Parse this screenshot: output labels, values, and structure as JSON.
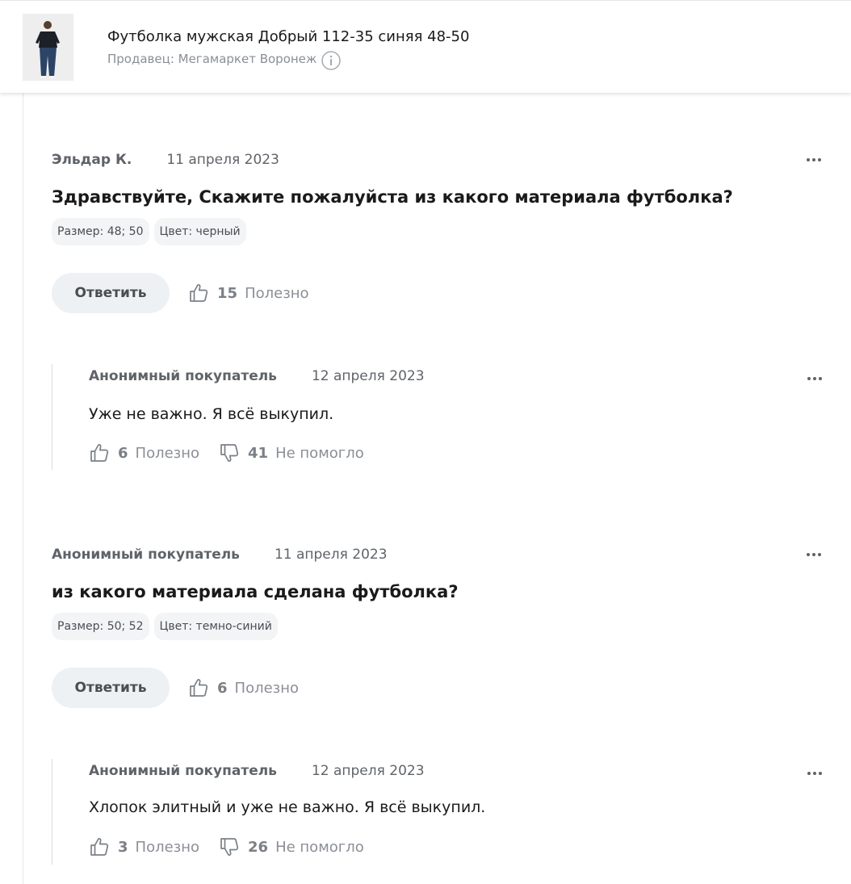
{
  "product": {
    "title": "Футболка мужская Добрый 112-35 синяя 48-50",
    "seller": "Продавец: Мегамаркет Воронеж",
    "thumbnail_icon": "product-photo"
  },
  "questions": [
    {
      "author": "Эльдар К.",
      "date": "11 апреля 2023",
      "text": "Здравствуйте, Скажите пожалуйста из какого материала футболка?",
      "tags": [
        "Размер: 48; 50",
        "Цвет: черный"
      ],
      "reply_label": "Ответить",
      "helpful_count": "15",
      "helpful_label": "Полезно",
      "answer": {
        "author": "Анонимный покупатель",
        "date": "12 апреля 2023",
        "text": "Уже не важно. Я всё выкупил.",
        "helpful_count": "6",
        "helpful_label": "Полезно",
        "unhelpful_count": "41",
        "unhelpful_label": "Не помогло"
      }
    },
    {
      "author": "Анонимный покупатель",
      "date": "11 апреля 2023",
      "text": "из какого материала сделана футболка?",
      "tags": [
        "Размер: 50; 52",
        "Цвет: темно-синий"
      ],
      "reply_label": "Ответить",
      "helpful_count": "6",
      "helpful_label": "Полезно",
      "answer": {
        "author": "Анонимный покупатель",
        "date": "12 апреля 2023",
        "text": "Хлопок элитный и уже не важно. Я всё выкупил.",
        "helpful_count": "3",
        "helpful_label": "Полезно",
        "unhelpful_count": "26",
        "unhelpful_label": "Не помогло"
      }
    }
  ],
  "colors": {
    "accent_text": "#5f6369",
    "button_bg": "#eef1f4",
    "tag_bg": "#f2f4f6"
  }
}
